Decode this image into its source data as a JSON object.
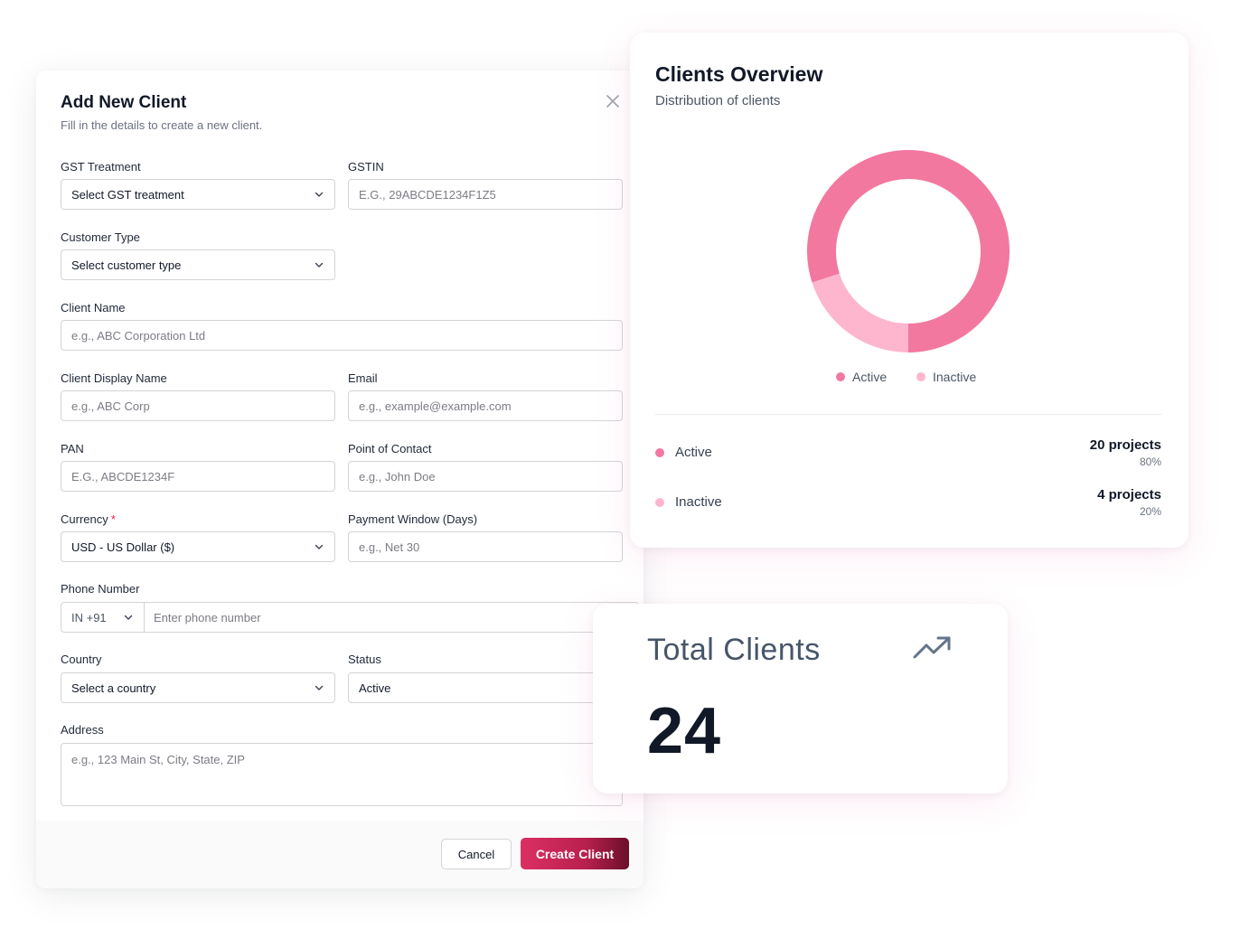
{
  "modal": {
    "title": "Add New Client",
    "subtitle": "Fill in the details to create a new client.",
    "close_icon": "close-icon",
    "fields": {
      "gst_treatment": {
        "label": "GST Treatment",
        "value": "Select GST treatment"
      },
      "gstin": {
        "label": "GSTIN",
        "placeholder": "E.G., 29ABCDE1234F1Z5"
      },
      "customer_type": {
        "label": "Customer Type",
        "value": "Select customer type"
      },
      "client_name": {
        "label": "Client Name",
        "placeholder": "e.g., ABC Corporation Ltd"
      },
      "client_display_name": {
        "label": "Client Display Name",
        "placeholder": "e.g., ABC Corp"
      },
      "email": {
        "label": "Email",
        "placeholder": "e.g., example@example.com"
      },
      "pan": {
        "label": "PAN",
        "placeholder": "E.G., ABCDE1234F"
      },
      "point_of_contact": {
        "label": "Point of Contact",
        "placeholder": "e.g., John Doe"
      },
      "currency": {
        "label": "Currency",
        "required_mark": "*",
        "value": "USD - US Dollar ($)"
      },
      "payment_window": {
        "label": "Payment Window (Days)",
        "placeholder": "e.g., Net 30"
      },
      "phone": {
        "label": "Phone Number",
        "code": "IN +91",
        "placeholder": "Enter phone number"
      },
      "country": {
        "label": "Country",
        "value": "Select a country"
      },
      "status": {
        "label": "Status",
        "value": "Active"
      },
      "address": {
        "label": "Address",
        "placeholder": "e.g., 123 Main St, City, State, ZIP"
      }
    },
    "buttons": {
      "cancel": "Cancel",
      "create": "Create Client"
    }
  },
  "overview": {
    "title": "Clients Overview",
    "subtitle": "Distribution of clients",
    "legend": {
      "active": "Active",
      "inactive": "Inactive"
    },
    "rows": [
      {
        "label": "Active",
        "projects": "20 projects",
        "percent": "80%"
      },
      {
        "label": "Inactive",
        "projects": "4 projects",
        "percent": "20%"
      }
    ],
    "colors": {
      "active": "#f2789f",
      "inactive": "#fdb6cd"
    }
  },
  "chart_data": {
    "type": "pie",
    "categories": [
      "Active",
      "Inactive"
    ],
    "values": [
      80,
      20
    ]
  },
  "total": {
    "label": "Total Clients",
    "value": "24",
    "icon": "trending-up-icon"
  }
}
